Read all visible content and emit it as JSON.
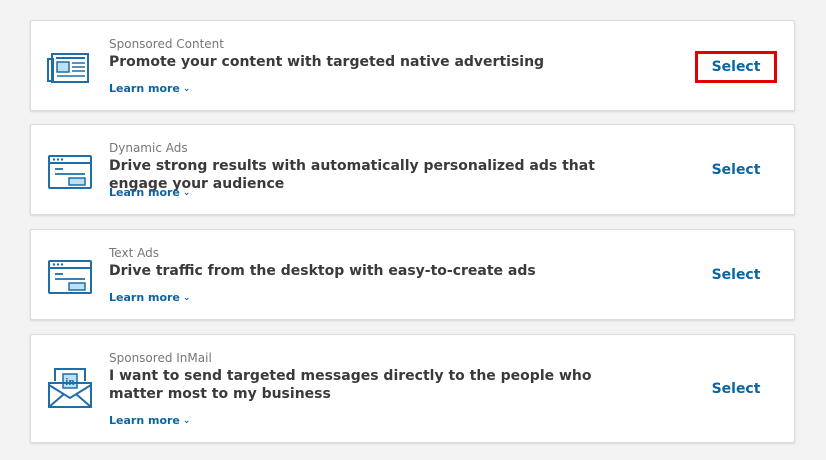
{
  "colors": {
    "accent": "#0a66a0",
    "highlight_border": "#e00000",
    "icon": "#1f6ea8",
    "icon_fill": "#bde0f5"
  },
  "learn_more_label": "Learn more",
  "select_label": "Select",
  "options": [
    {
      "kicker": "Sponsored Content",
      "title": "Promote your content with targeted native advertising",
      "icon": "newspaper-icon",
      "selected_highlight": true
    },
    {
      "kicker": "Dynamic Ads",
      "title": "Drive strong results with automatically personalized ads that engage your audience",
      "icon": "browser-window-icon",
      "selected_highlight": false
    },
    {
      "kicker": "Text Ads",
      "title": "Drive traffic from the desktop with easy-to-create ads",
      "icon": "browser-window-icon",
      "selected_highlight": false
    },
    {
      "kicker": "Sponsored InMail",
      "title": "I want to send targeted messages directly to the people who matter most to my business",
      "icon": "linkedin-envelope-icon",
      "selected_highlight": false
    }
  ]
}
